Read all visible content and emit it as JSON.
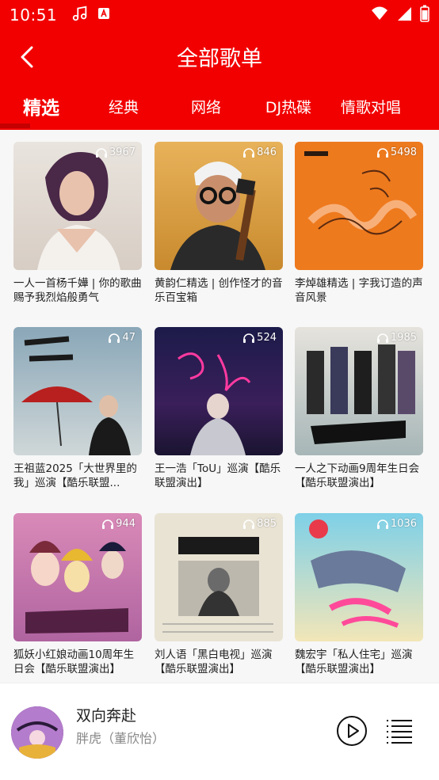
{
  "status": {
    "time": "10:51"
  },
  "header": {
    "title": "全部歌单"
  },
  "tabs": [
    "精选",
    "经典",
    "网络",
    "DJ热碟",
    "情歌对唱"
  ],
  "colors": {
    "brand": "#f20000",
    "indicator": "#c40000"
  },
  "playlists": [
    {
      "name": "一人一首杨千嬅 | 你的歌曲赐予我烈焰般勇气",
      "plays": "3967"
    },
    {
      "name": "黄韵仁精选 | 创作怪才的音乐百宝箱",
      "plays": "846"
    },
    {
      "name": "李焯雄精选 | 字我订造的声音风景",
      "plays": "5498"
    },
    {
      "name": "王祖蓝2025「大世界里的我」巡演【酷乐联盟...",
      "plays": "47"
    },
    {
      "name": "王一浩「ToU」巡演【酷乐联盟演出】",
      "plays": "524"
    },
    {
      "name": "一人之下动画9周年生日会【酷乐联盟演出】",
      "plays": "1985"
    },
    {
      "name": "狐妖小红娘动画10周年生日会【酷乐联盟演出】",
      "plays": "944"
    },
    {
      "name": "刘人语「黑白电视」巡演【酷乐联盟演出】",
      "plays": "885"
    },
    {
      "name": "魏宏宇「私人住宅」巡演【酷乐联盟演出】",
      "plays": "1036"
    }
  ],
  "player": {
    "song": "双向奔赴",
    "artist": "胖虎（董欣怡）"
  }
}
